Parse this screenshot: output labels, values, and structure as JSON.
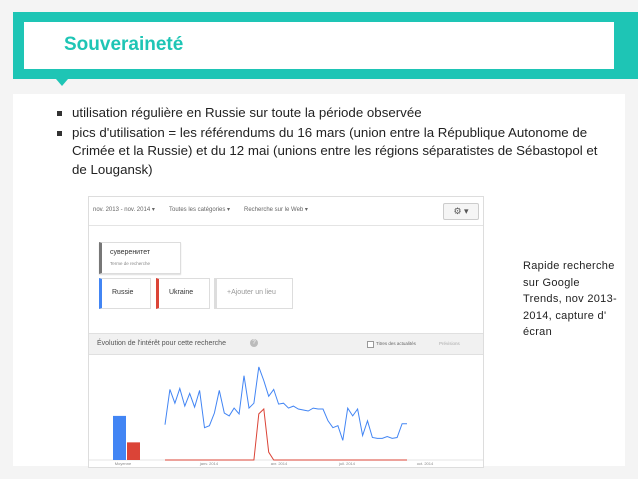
{
  "slide": {
    "title": "Souveraineté",
    "bullets": [
      "utilisation régulière en Russie sur toute la période observée",
      "pics d'utilisation = les référendums du 16 mars (union entre la République Autonome de Crimée et la Russie) et du 12 mai (unions entre les régions séparatistes de Sébastopol et de Lougansk)"
    ],
    "side_note": "Rapide recherche sur Google Trends, nov 2013-2014, capture d' écran"
  },
  "trends": {
    "toolbar": {
      "date_range": "nov. 2013 - nov. 2014 ▾",
      "categories": "Toutes les catégories ▾",
      "search_type": "Recherche sur le Web ▾",
      "gear": "⚙ ▾"
    },
    "term": {
      "word": "суверенитет",
      "label": "Terme de recherche"
    },
    "compare": [
      {
        "label": "Russie",
        "color": "#4285f4"
      },
      {
        "label": "Ukraine",
        "color": "#db4437"
      },
      {
        "label": "+Ajouter un lieu",
        "color": "#dddddd"
      }
    ],
    "panel": {
      "title": "Évolution de l'intérêt pour cette recherche",
      "help": "?",
      "news_checkbox": "Titres des actualités",
      "forecast": "Prévisions"
    },
    "chart_data": {
      "type": "line",
      "x_labels": [
        "Moyenne",
        "janv. 2014",
        "avr. 2014",
        "juil. 2014",
        "oct. 2014"
      ],
      "average_bars": [
        {
          "name": "Russie",
          "value": 45,
          "color": "#4285f4"
        },
        {
          "name": "Ukraine",
          "value": 18,
          "color": "#db4437"
        }
      ],
      "ylim": [
        0,
        100
      ],
      "series": [
        {
          "name": "Russie",
          "color": "#4285f4",
          "values": [
            36,
            72,
            58,
            73,
            55,
            68,
            54,
            71,
            33,
            35,
            48,
            71,
            48,
            45,
            53,
            47,
            86,
            53,
            58,
            95,
            81,
            65,
            72,
            57,
            58,
            53,
            55,
            52,
            51,
            50,
            53,
            52,
            52,
            40,
            33,
            35,
            20,
            53,
            45,
            52,
            25,
            40,
            23,
            22,
            22,
            24,
            22,
            23,
            37,
            37
          ]
        },
        {
          "name": "Ukraine",
          "color": "#db4437",
          "values": [
            0,
            0,
            0,
            0,
            0,
            0,
            0,
            0,
            0,
            0,
            0,
            0,
            0,
            0,
            0,
            0,
            0,
            0,
            0,
            47,
            52,
            8,
            0,
            0,
            0,
            0,
            0,
            0,
            0,
            0,
            0,
            0,
            0,
            0,
            0,
            0,
            0,
            0,
            0,
            0,
            0,
            0,
            0,
            0,
            0,
            0,
            0,
            0,
            0,
            0
          ]
        }
      ]
    }
  }
}
